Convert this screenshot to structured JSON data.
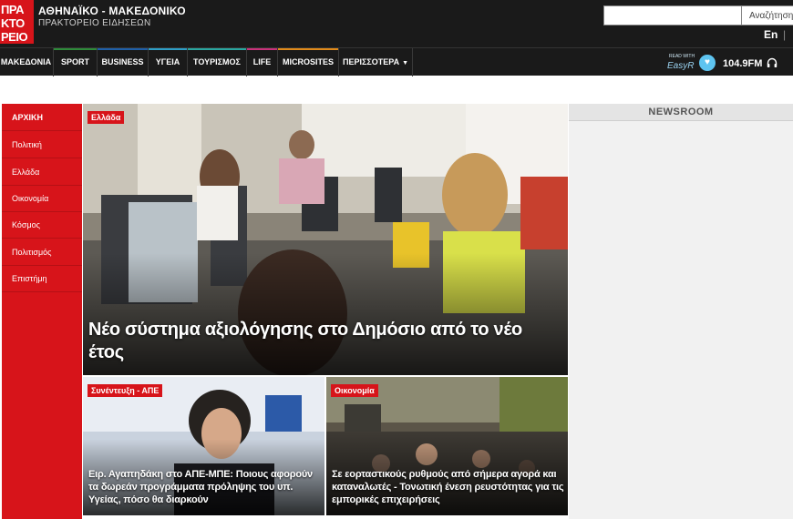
{
  "logo": {
    "lines": [
      "ΠΡΑ",
      "ΚΤΟ",
      "ΡΕΙΟ"
    ]
  },
  "brand": {
    "title": "ΑΘΗΝΑΪΚΟ - ΜΑΚΕΔΟΝΙΚΟ",
    "subtitle": "ΠΡΑΚΤΟΡΕΙΟ ΕΙΔΗΣΕΩΝ"
  },
  "search": {
    "value": "",
    "button_label": "Αναζήτηση"
  },
  "language": {
    "label": "En",
    "separator": "|"
  },
  "nav": {
    "items": [
      {
        "label": "ΜΑΚΕΔΟΝΙΑ",
        "accent": "#1a1a1a"
      },
      {
        "label": "SPORT",
        "accent": "#2e8b3a"
      },
      {
        "label": "BUSINESS",
        "accent": "#1f5fa8"
      },
      {
        "label": "ΥΓΕΙΑ",
        "accent": "#2e9ec6"
      },
      {
        "label": "ΤΟΥΡΙΣΜΟΣ",
        "accent": "#2aa6a0"
      },
      {
        "label": "LIFE",
        "accent": "#c8327a"
      },
      {
        "label": "MICROSITES",
        "accent": "#e08a1a"
      },
      {
        "label": "ΠΕΡΙΣΣΟΤΕΡΑ",
        "accent": "#1a1a1a"
      }
    ],
    "easyr_small": "READ WITH",
    "easyr_word": "EasyR",
    "radio": "104.9FM"
  },
  "sidebar": {
    "items": [
      {
        "label": "ΑΡΧΙΚΗ"
      },
      {
        "label": "Πολιτική"
      },
      {
        "label": "Ελλάδα"
      },
      {
        "label": "Οικονομία"
      },
      {
        "label": "Κόσμος"
      },
      {
        "label": "Πολιτισμός"
      },
      {
        "label": "Επιστήμη"
      }
    ]
  },
  "hero": {
    "tag": "Ελλάδα",
    "title": "Νέο σύστημα αξιολόγησης στο Δημόσιο από το νέο έτος"
  },
  "cards": [
    {
      "tag": "Συνέντευξη - ΑΠΕ",
      "title": "Ειρ. Αγαπηδάκη στο ΑΠΕ-ΜΠΕ: Ποιους αφορούν τα δωρεάν προγράμματα πρόληψης του υπ. Υγείας, πόσο θα διαρκούν"
    },
    {
      "tag": "Οικονομία",
      "title": "Σε εορταστικούς ρυθμούς από σήμερα αγορά και καταναλωτές - Τονωτική ένεση ρευστότητας για τις εμπορικές επιχειρήσεις"
    }
  ],
  "newsroom": {
    "title": "NEWSROOM"
  },
  "colors": {
    "brand_red": "#d7141a",
    "topbar": "#1a1a1a",
    "newsroom_bg": "#f1f1f1"
  }
}
